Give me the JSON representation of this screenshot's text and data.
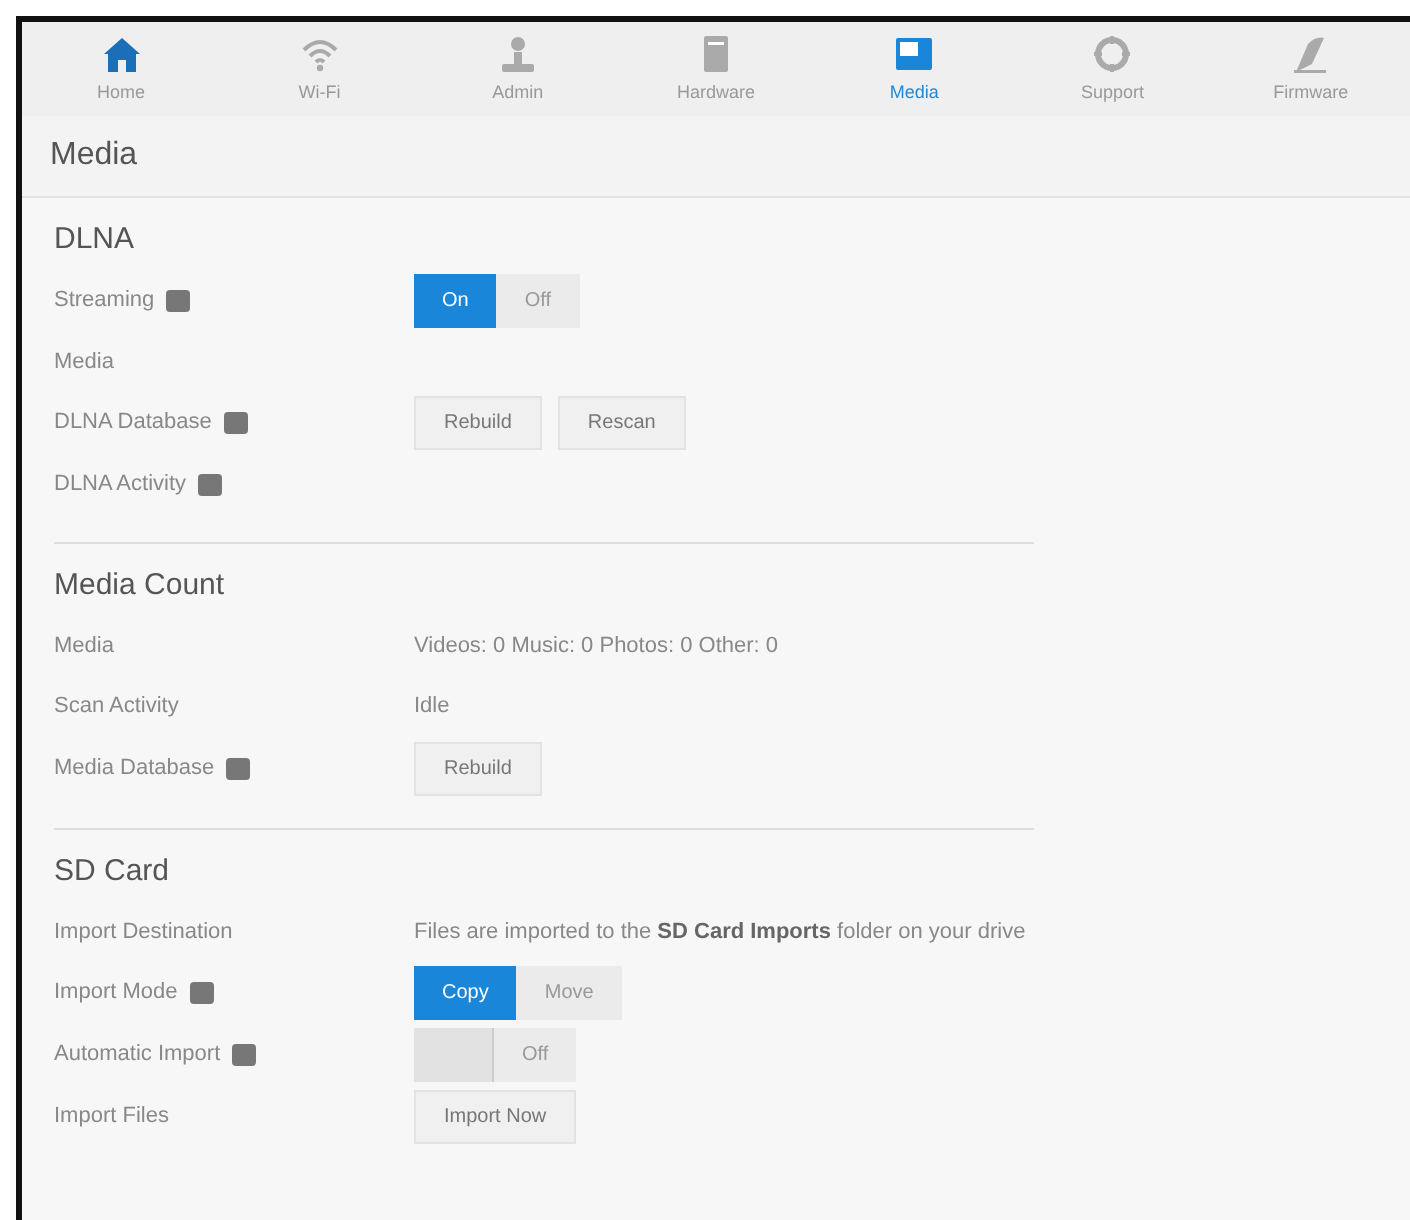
{
  "nav": [
    {
      "label": "Home",
      "kind": "home",
      "selected": false
    },
    {
      "label": "Wi-Fi",
      "kind": "wifi",
      "selected": false
    },
    {
      "label": "Admin",
      "kind": "admin",
      "selected": false
    },
    {
      "label": "Hardware",
      "kind": "hardware",
      "selected": false
    },
    {
      "label": "Media",
      "kind": "media",
      "selected": true
    },
    {
      "label": "Support",
      "kind": "support",
      "selected": false
    },
    {
      "label": "Firmware",
      "kind": "firmware",
      "selected": false
    }
  ],
  "page_title": "Media",
  "sections": [
    {
      "title": "DLNA",
      "rows": [
        {
          "kind": "segmented",
          "label": "Streaming",
          "info": true,
          "options": [
            {
              "label": "On",
              "selected": true
            },
            {
              "label": "Off",
              "selected": false
            }
          ]
        },
        {
          "kind": "text",
          "label": "Media",
          "info": false
        },
        {
          "kind": "buttons",
          "label": "DLNA Database",
          "info": true,
          "buttons": [
            "Rebuild",
            "Rescan"
          ]
        },
        {
          "kind": "text",
          "label": "DLNA Activity",
          "info": true
        }
      ]
    },
    {
      "title": "Media Count",
      "rows": [
        {
          "kind": "text",
          "label": "Media",
          "info": false,
          "value": "Videos: 0   Music: 0   Photos: 0   Other: 0"
        },
        {
          "kind": "text",
          "label": "Scan Activity",
          "info": false,
          "value": "Idle"
        },
        {
          "kind": "buttons",
          "label": "Media Database",
          "info": true,
          "buttons": [
            "Rebuild"
          ]
        }
      ]
    },
    {
      "title": "SD Card",
      "rows": [
        {
          "kind": "text",
          "label": "Import Destination",
          "info": false,
          "value": "Files are imported to the **SD Card Imports** folder on your drive"
        },
        {
          "kind": "segmented",
          "label": "Import Mode",
          "info": true,
          "options": [
            {
              "label": "Copy",
              "selected": true
            },
            {
              "label": "Move",
              "selected": false
            }
          ]
        },
        {
          "kind": "switch",
          "label": "Automatic Import",
          "info": true,
          "on": false,
          "text": "Off"
        },
        {
          "kind": "buttons",
          "label": "Import Files",
          "info": false,
          "buttons": [
            "Import Now"
          ]
        }
      ]
    }
  ]
}
